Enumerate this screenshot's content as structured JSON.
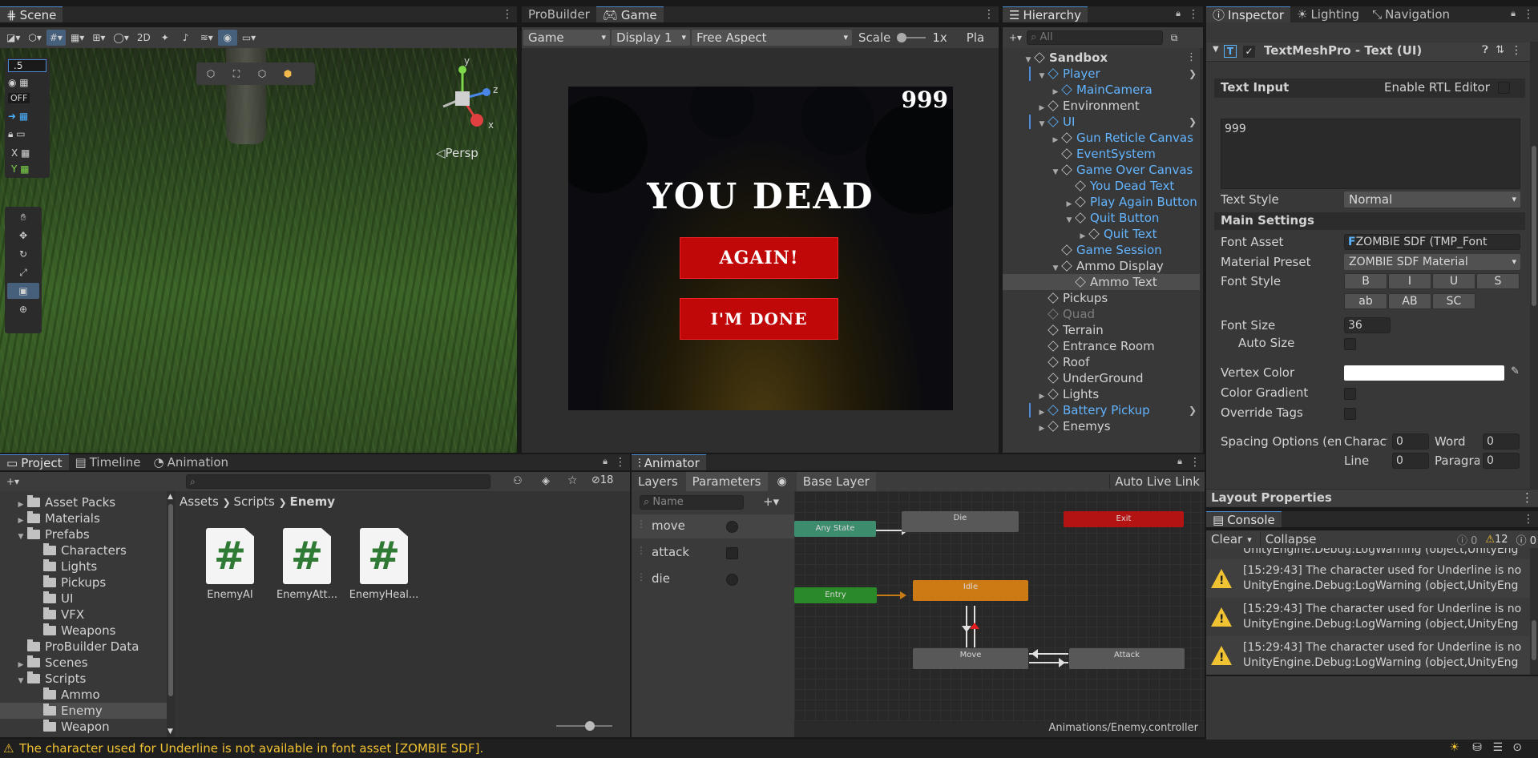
{
  "scene": {
    "tab": "Scene",
    "toolbar": {
      "twod": "2D"
    },
    "overlay": {
      "snap_value": ".5",
      "off_label": "OFF",
      "x_label": "X",
      "y_label": "Y"
    },
    "persp_label": "◁Persp",
    "gizmo": {
      "x": "x",
      "y": "y",
      "z": "z"
    }
  },
  "game": {
    "tabs": [
      "ProBuilder",
      "Game"
    ],
    "toolbar": {
      "mode": "Game",
      "display": "Display 1",
      "aspect": "Free Aspect",
      "scale_label": "Scale",
      "scale_value": "1x",
      "play_label": "Pla"
    },
    "score": "999",
    "title": "YOU DEAD",
    "again_button": "AGAIN!",
    "done_button": "I'M DONE"
  },
  "hierarchy": {
    "tab": "Hierarchy",
    "search_placeholder": "All",
    "items": [
      {
        "label": "Sandbox",
        "indent": 0,
        "arrow": "▼",
        "icon": "unity",
        "style": "bold"
      },
      {
        "label": "Player",
        "indent": 1,
        "arrow": "▼",
        "icon": "blue",
        "style": "blue",
        "more": true
      },
      {
        "label": "MainCamera",
        "indent": 2,
        "arrow": "▶",
        "icon": "blue",
        "style": "blue"
      },
      {
        "label": "Environment",
        "indent": 1,
        "arrow": "▶",
        "icon": "",
        "style": ""
      },
      {
        "label": "UI",
        "indent": 1,
        "arrow": "▼",
        "icon": "blue",
        "style": "blue",
        "more": true
      },
      {
        "label": "Gun Reticle Canvas",
        "indent": 2,
        "arrow": "▶",
        "icon": "",
        "style": "blue"
      },
      {
        "label": "EventSystem",
        "indent": 2,
        "arrow": "",
        "icon": "",
        "style": "blue"
      },
      {
        "label": "Game Over Canvas",
        "indent": 2,
        "arrow": "▼",
        "icon": "",
        "style": "blue"
      },
      {
        "label": "You Dead Text",
        "indent": 3,
        "arrow": "",
        "icon": "",
        "style": "blue"
      },
      {
        "label": "Play Again Button",
        "indent": 3,
        "arrow": "▶",
        "icon": "",
        "style": "blue"
      },
      {
        "label": "Quit Button",
        "indent": 3,
        "arrow": "▼",
        "icon": "",
        "style": "blue"
      },
      {
        "label": "Quit Text",
        "indent": 4,
        "arrow": "▶",
        "icon": "",
        "style": "blue"
      },
      {
        "label": "Game Session",
        "indent": 2,
        "arrow": "",
        "icon": "",
        "style": "blue"
      },
      {
        "label": "Ammo Display",
        "indent": 2,
        "arrow": "▼",
        "icon": "",
        "style": ""
      },
      {
        "label": "Ammo Text",
        "indent": 3,
        "arrow": "",
        "icon": "",
        "style": "",
        "selected": true
      },
      {
        "label": "Pickups",
        "indent": 1,
        "arrow": "",
        "icon": "",
        "style": ""
      },
      {
        "label": "Quad",
        "indent": 1,
        "arrow": "",
        "icon": "grey",
        "style": "grey"
      },
      {
        "label": "Terrain",
        "indent": 1,
        "arrow": "",
        "icon": "",
        "style": ""
      },
      {
        "label": "Entrance Room",
        "indent": 1,
        "arrow": "",
        "icon": "",
        "style": ""
      },
      {
        "label": "Roof",
        "indent": 1,
        "arrow": "",
        "icon": "",
        "style": ""
      },
      {
        "label": "UnderGround",
        "indent": 1,
        "arrow": "",
        "icon": "",
        "style": ""
      },
      {
        "label": "Lights",
        "indent": 1,
        "arrow": "▶",
        "icon": "",
        "style": ""
      },
      {
        "label": "Battery Pickup",
        "indent": 1,
        "arrow": "▶",
        "icon": "blue",
        "style": "blue",
        "more": true
      },
      {
        "label": "Enemys",
        "indent": 1,
        "arrow": "▶",
        "icon": "",
        "style": ""
      }
    ]
  },
  "inspector": {
    "tabs": [
      "Inspector",
      "Lighting",
      "Navigation"
    ],
    "component_title": "TextMeshPro - Text (UI)",
    "text_input_label": "Text Input",
    "rtl_label": "Enable RTL Editor",
    "text_value": "999",
    "text_style_label": "Text Style",
    "text_style_value": "Normal",
    "main_settings_label": "Main Settings",
    "font_asset_label": "Font Asset",
    "font_asset_value": "ZOMBIE SDF (TMP_Font",
    "material_preset_label": "Material Preset",
    "material_preset_value": "ZOMBIE SDF Material",
    "font_style_label": "Font Style",
    "font_style_buttons": [
      "B",
      "I",
      "U",
      "S",
      "ab",
      "AB",
      "SC"
    ],
    "font_size_label": "Font Size",
    "font_size_value": "36",
    "auto_size_label": "Auto Size",
    "vertex_color_label": "Vertex Color",
    "color_gradient_label": "Color Gradient",
    "override_tags_label": "Override Tags",
    "spacing_label": "Spacing Options (em)",
    "character_label": "Charact",
    "character_value": "0",
    "word_label": "Word",
    "word_value": "0",
    "line_label": "Line",
    "line_value": "0",
    "paragraph_label": "Paragra",
    "paragraph_value": "0",
    "layout_properties_label": "Layout Properties"
  },
  "console": {
    "tab": "Console",
    "clear_label": "Clear",
    "collapse_label": "Collapse",
    "counts": {
      "errors": "0",
      "warnings": "12",
      "infos": "0"
    },
    "partial_line": "UnityEngine.Debug:LogWarning (object,UnityEng",
    "entries": [
      {
        "line1": "[15:29:43] The character used for Underline is no",
        "line2": "UnityEngine.Debug:LogWarning (object,UnityEng"
      },
      {
        "line1": "[15:29:43] The character used for Underline is no",
        "line2": "UnityEngine.Debug:LogWarning (object,UnityEng"
      },
      {
        "line1": "[15:29:43] The character used for Underline is no",
        "line2": "UnityEngine.Debug:LogWarning (object,UnityEng"
      }
    ]
  },
  "project": {
    "tabs": [
      "Project",
      "Timeline",
      "Animation"
    ],
    "hidden_count": "18",
    "breadcrumb": [
      "Assets",
      "Scripts",
      "Enemy"
    ],
    "tree": [
      {
        "label": "Asset Packs",
        "indent": 1,
        "arrow": "▶"
      },
      {
        "label": "Materials",
        "indent": 1,
        "arrow": "▶"
      },
      {
        "label": "Prefabs",
        "indent": 1,
        "arrow": "▼"
      },
      {
        "label": "Characters",
        "indent": 2,
        "arrow": ""
      },
      {
        "label": "Lights",
        "indent": 2,
        "arrow": ""
      },
      {
        "label": "Pickups",
        "indent": 2,
        "arrow": ""
      },
      {
        "label": "UI",
        "indent": 2,
        "arrow": ""
      },
      {
        "label": "VFX",
        "indent": 2,
        "arrow": ""
      },
      {
        "label": "Weapons",
        "indent": 2,
        "arrow": ""
      },
      {
        "label": "ProBuilder Data",
        "indent": 1,
        "arrow": ""
      },
      {
        "label": "Scenes",
        "indent": 1,
        "arrow": "▶"
      },
      {
        "label": "Scripts",
        "indent": 1,
        "arrow": "▼"
      },
      {
        "label": "Ammo",
        "indent": 2,
        "arrow": ""
      },
      {
        "label": "Enemy",
        "indent": 2,
        "arrow": "",
        "selected": true
      },
      {
        "label": "Weapon",
        "indent": 2,
        "arrow": ""
      }
    ],
    "files": [
      "EnemyAI",
      "EnemyAtt...",
      "EnemyHeal..."
    ]
  },
  "animator": {
    "tab": "Animator",
    "layers_tab": "Layers",
    "parameters_tab": "Parameters",
    "base_layer": "Base Layer",
    "auto_live_link": "Auto Live Link",
    "search_placeholder": "Name",
    "parameters": [
      {
        "name": "move",
        "type": "bool"
      },
      {
        "name": "attack",
        "type": "trigger"
      },
      {
        "name": "die",
        "type": "bool"
      }
    ],
    "states": {
      "any": "Any State",
      "die": "Die",
      "exit": "Exit",
      "entry": "Entry",
      "idle": "Idle",
      "move": "Move",
      "attack": "Attack"
    },
    "footer": "Animations/Enemy.controller"
  },
  "statusbar": {
    "message": "The character used for Underline is not available in font asset [ZOMBIE SDF]."
  }
}
